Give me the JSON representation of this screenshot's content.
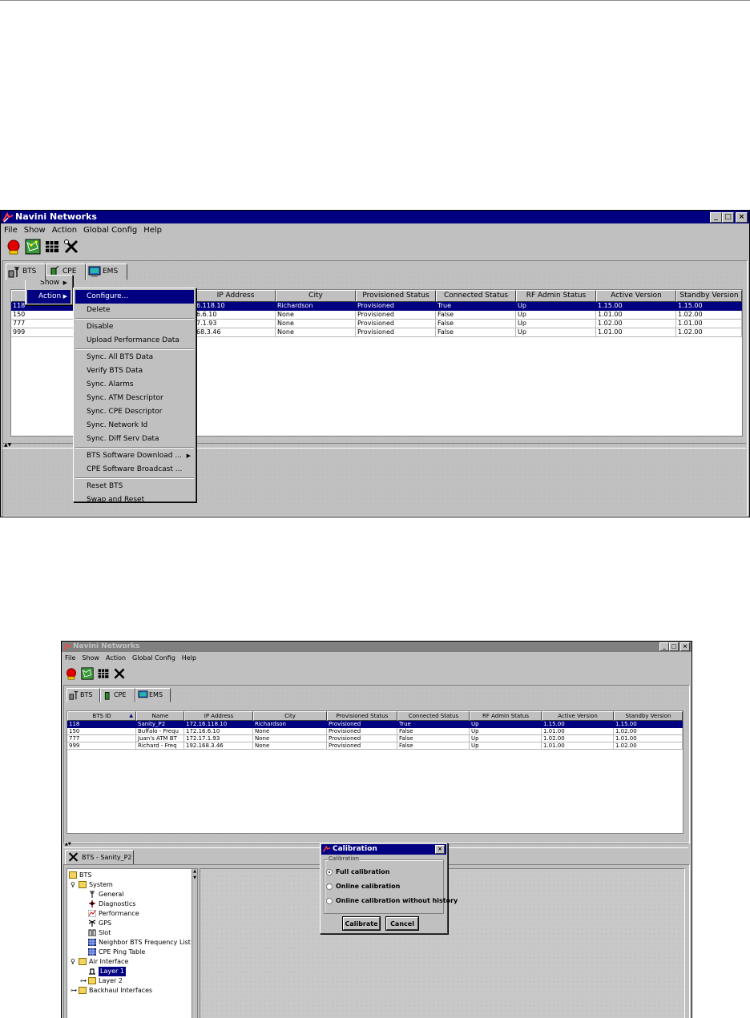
{
  "top": {
    "window": {
      "title": "Navini Networks",
      "controls": [
        "_",
        "□",
        "×"
      ],
      "menu": [
        "File",
        "Show",
        "Action",
        "Global Config",
        "Help"
      ],
      "toolbar_icons": [
        "alarm-light-icon",
        "network-map-icon",
        "grid-icon",
        "tools-icon"
      ],
      "tabs": [
        {
          "label": "BTS",
          "icon": "antenna-icon"
        },
        {
          "label": "CPE",
          "icon": "cpe-modem-icon"
        },
        {
          "label": "EMS",
          "icon": "monitor-icon"
        }
      ]
    },
    "table": {
      "columns": [
        "IP Address",
        "City",
        "Provisioned Status",
        "Connected Status",
        "RF Admin Status",
        "Active Version",
        "Standby Version"
      ],
      "rows": [
        {
          "bts_id": "118",
          "ip": "6.118.10",
          "city": "Richardson",
          "prov": "Provisioned",
          "conn": "True",
          "rf": "Up",
          "active": "1.15.00",
          "standby": "1.15.00"
        },
        {
          "bts_id": "150",
          "ip": "6.6.10",
          "city": "None",
          "prov": "Provisioned",
          "conn": "False",
          "rf": "Up",
          "active": "1.01.00",
          "standby": "1.02.00"
        },
        {
          "bts_id": "777",
          "ip": "7.1.93",
          "city": "None",
          "prov": "Provisioned",
          "conn": "False",
          "rf": "Up",
          "active": "1.02.00",
          "standby": "1.01.00"
        },
        {
          "bts_id": "999",
          "ip": "68.3.46",
          "city": "None",
          "prov": "Provisioned",
          "conn": "False",
          "rf": "Up",
          "active": "1.01.00",
          "standby": "1.02.00"
        }
      ]
    },
    "context_menu": {
      "items": [
        "Show",
        "Action"
      ],
      "arrow": "▶"
    },
    "action_submenu": {
      "items": [
        {
          "label": "Configure...",
          "highlighted": true
        },
        {
          "label": "Delete"
        },
        {
          "sep": true
        },
        {
          "label": "Disable"
        },
        {
          "label": "Upload Performance Data"
        },
        {
          "sep": true
        },
        {
          "label": "Sync. All BTS Data"
        },
        {
          "label": "Verify BTS Data"
        },
        {
          "label": "Sync. Alarms"
        },
        {
          "label": "Sync. ATM Descriptor"
        },
        {
          "label": "Sync. CPE Descriptor"
        },
        {
          "label": "Sync. Network Id"
        },
        {
          "label": "Sync. Diff Serv Data"
        },
        {
          "sep": true
        },
        {
          "label": "BTS Software Download ...",
          "submenu": true
        },
        {
          "label": "CPE Software Broadcast ..."
        },
        {
          "sep": true
        },
        {
          "label": "Reset BTS"
        },
        {
          "label": "Swap and Reset"
        }
      ]
    }
  },
  "bottom": {
    "window": {
      "title": "Navini Networks",
      "controls": [
        "_",
        "□",
        "×"
      ],
      "menu": [
        "File",
        "Show",
        "Action",
        "Global Config",
        "Help"
      ],
      "tabs": [
        {
          "label": "BTS",
          "icon": "antenna-icon"
        },
        {
          "label": "CPE",
          "icon": "cpe-modem-icon"
        },
        {
          "label": "EMS",
          "icon": "monitor-icon"
        }
      ]
    },
    "table": {
      "columns": [
        "BTS ID",
        "Name",
        "IP Address",
        "City",
        "Provisioned Status",
        "Connected Status",
        "RF Admin Status",
        "Active Version",
        "Standby Version"
      ],
      "sort_indicator": "▲",
      "rows": [
        {
          "bts_id": "118",
          "name": "Sanity_P2",
          "ip": "172.16.118.10",
          "city": "Richardson",
          "prov": "Provisioned",
          "conn": "True",
          "rf": "Up",
          "active": "1.15.00",
          "standby": "1.15.00"
        },
        {
          "bts_id": "150",
          "name": "Buffalo - Frequ",
          "ip": "172.16.6.10",
          "city": "None",
          "prov": "Provisioned",
          "conn": "False",
          "rf": "Up",
          "active": "1.01.00",
          "standby": "1.02.00"
        },
        {
          "bts_id": "777",
          "name": "Juan's ATM BT",
          "ip": "172.17.1.93",
          "city": "None",
          "prov": "Provisioned",
          "conn": "False",
          "rf": "Up",
          "active": "1.02.00",
          "standby": "1.01.00"
        },
        {
          "bts_id": "999",
          "name": "Richard - Freq",
          "ip": "192.168.3.46",
          "city": "None",
          "prov": "Provisioned",
          "conn": "False",
          "rf": "Up",
          "active": "1.01.00",
          "standby": "1.02.00"
        }
      ]
    },
    "detail_tab": "BTS - Sanity_P2",
    "tree": [
      {
        "label": "BTS",
        "kind": "folder",
        "depth": 0
      },
      {
        "label": "System",
        "kind": "folder",
        "depth": 1,
        "expander": "♀"
      },
      {
        "label": "General",
        "kind": "antenna",
        "depth": 2
      },
      {
        "label": "Diagnostics",
        "kind": "diag",
        "depth": 2
      },
      {
        "label": "Performance",
        "kind": "perf",
        "depth": 2
      },
      {
        "label": "GPS",
        "kind": "gps",
        "depth": 2
      },
      {
        "label": "Slot",
        "kind": "slot",
        "depth": 2
      },
      {
        "label": "Neighbor BTS Frequency List",
        "kind": "table",
        "depth": 2
      },
      {
        "label": "CPE Ping Table",
        "kind": "table",
        "depth": 2
      },
      {
        "label": "Air Interface",
        "kind": "folder",
        "depth": 1,
        "expander": "♀"
      },
      {
        "label": "Layer 1",
        "kind": "layer",
        "depth": 2,
        "selected": true
      },
      {
        "label": "Layer 2",
        "kind": "folder",
        "depth": 2,
        "expander": "⊶"
      },
      {
        "label": "Backhaul Interfaces",
        "kind": "folder",
        "depth": 1,
        "expander": "⊶"
      }
    ],
    "dialog": {
      "title": "Calibration",
      "close": "×",
      "group_label": "Calibration",
      "options": [
        {
          "label": "Full calibration",
          "checked": true
        },
        {
          "label": "Online calibration",
          "checked": false
        },
        {
          "label": "Online calibration without history",
          "checked": false
        }
      ],
      "buttons": [
        "Calibrate",
        "Cancel"
      ]
    }
  }
}
